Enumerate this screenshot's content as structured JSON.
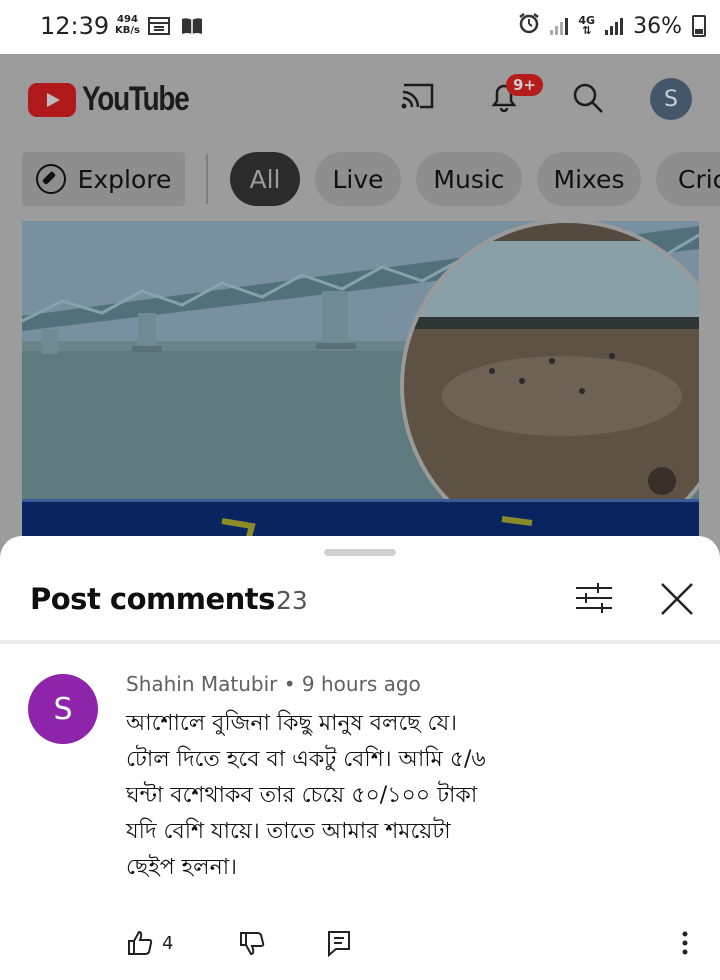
{
  "status_bar": {
    "time": "12:39",
    "speed_value": "494",
    "speed_unit": "KB/s",
    "network": "4G",
    "battery": "36%"
  },
  "youtube": {
    "logo_text": "YouTube",
    "notification_badge": "9+",
    "avatar_letter": "S",
    "chips": [
      "Explore",
      "All",
      "Live",
      "Music",
      "Mixes",
      "Cric"
    ],
    "active_chip": "All"
  },
  "comments_sheet": {
    "title": "Post comments",
    "count": "23",
    "comment": {
      "avatar_letter": "S",
      "avatar_color": "#8e24aa",
      "author": "Shahin Matubir",
      "separator": "•",
      "time": "9 hours ago",
      "text": "আশোলে বুজিনা কিছু মানুষ বলছে যে।\nটোল দিতে হবে বা একটু বেশি। আমি ৫/৬\nঘন্টা বশেথাকব তার চেয়ে ৫০/১০০ টাকা\nযদি বেশি যায়ে। তাতে আমার শময়েটা\nছেইপ হলনা।",
      "likes": "4"
    }
  }
}
